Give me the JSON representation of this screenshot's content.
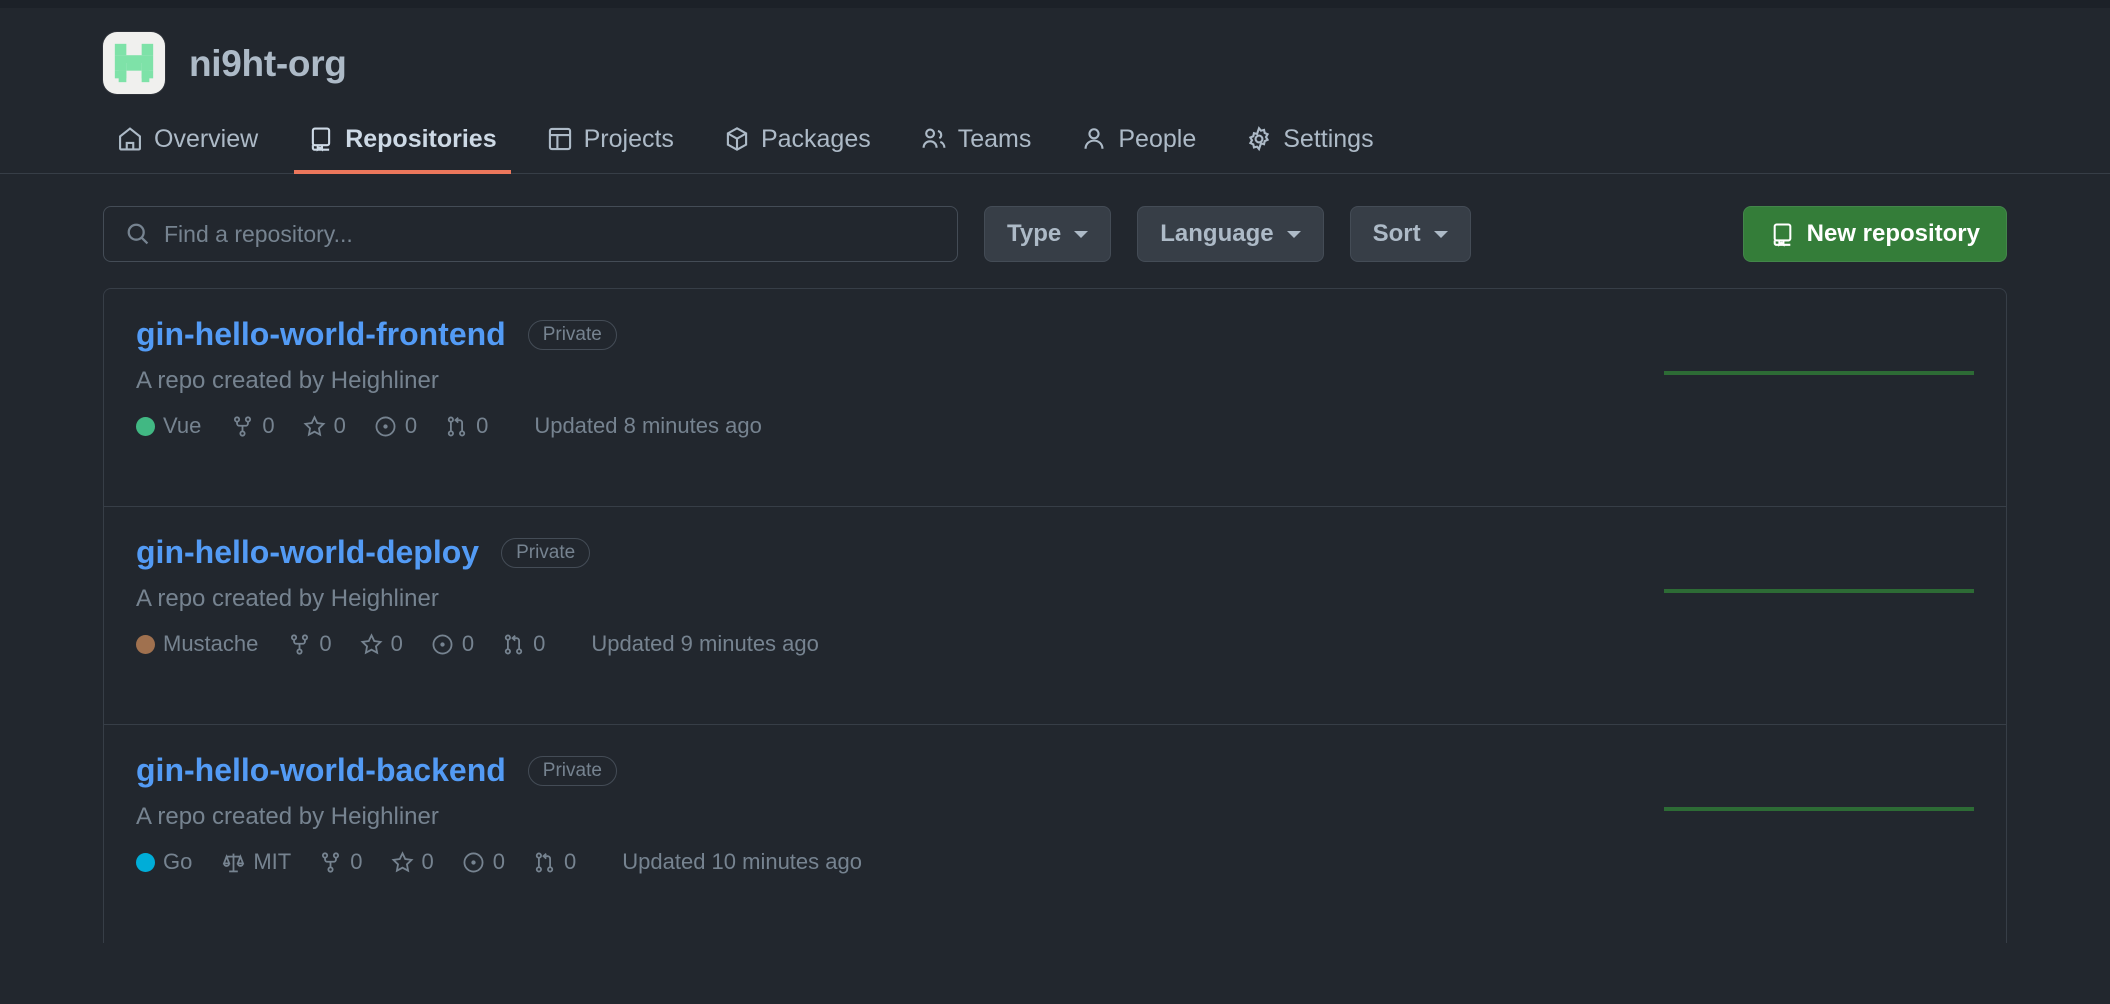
{
  "org": {
    "name": "ni9ht-org",
    "avatar_icon": "org-logo-h-mark",
    "avatar_bg": "#f0f0ee",
    "avatar_fg": "#7ee2a8"
  },
  "nav": {
    "active": "Repositories",
    "accent_color": "#ec775c",
    "items": [
      {
        "label": "Overview",
        "icon": "home-icon"
      },
      {
        "label": "Repositories",
        "icon": "repo-icon"
      },
      {
        "label": "Projects",
        "icon": "project-icon"
      },
      {
        "label": "Packages",
        "icon": "package-icon"
      },
      {
        "label": "Teams",
        "icon": "people-icon"
      },
      {
        "label": "People",
        "icon": "person-icon"
      },
      {
        "label": "Settings",
        "icon": "gear-icon"
      }
    ]
  },
  "filters": {
    "search": {
      "placeholder": "Find a repository...",
      "value": "",
      "icon": "search-icon"
    },
    "type_label": "Type",
    "language_label": "Language",
    "sort_label": "Sort",
    "new_repo_label": "New repository",
    "new_repo_color": "#347d39"
  },
  "repositories": [
    {
      "name": "gin-hello-world-frontend",
      "visibility": "Private",
      "description": "A repo created by Heighliner",
      "language": "Vue",
      "language_color": "#41b883",
      "license": "",
      "forks": "0",
      "stars": "0",
      "issues": "0",
      "pull_requests": "0",
      "updated": "Updated 8 minutes ago"
    },
    {
      "name": "gin-hello-world-deploy",
      "visibility": "Private",
      "description": "A repo created by Heighliner",
      "language": "Mustache",
      "language_color": "#a0714f",
      "license": "",
      "forks": "0",
      "stars": "0",
      "issues": "0",
      "pull_requests": "0",
      "updated": "Updated 9 minutes ago"
    },
    {
      "name": "gin-hello-world-backend",
      "visibility": "Private",
      "description": "A repo created by Heighliner",
      "language": "Go",
      "language_color": "#00add8",
      "license": "MIT",
      "forks": "0",
      "stars": "0",
      "issues": "0",
      "pull_requests": "0",
      "updated": "Updated 10 minutes ago"
    }
  ],
  "sparkline": {
    "color": "#2d6b35",
    "values": [
      0,
      0,
      0,
      0,
      0,
      0,
      0,
      0,
      0,
      0,
      0,
      0
    ]
  }
}
